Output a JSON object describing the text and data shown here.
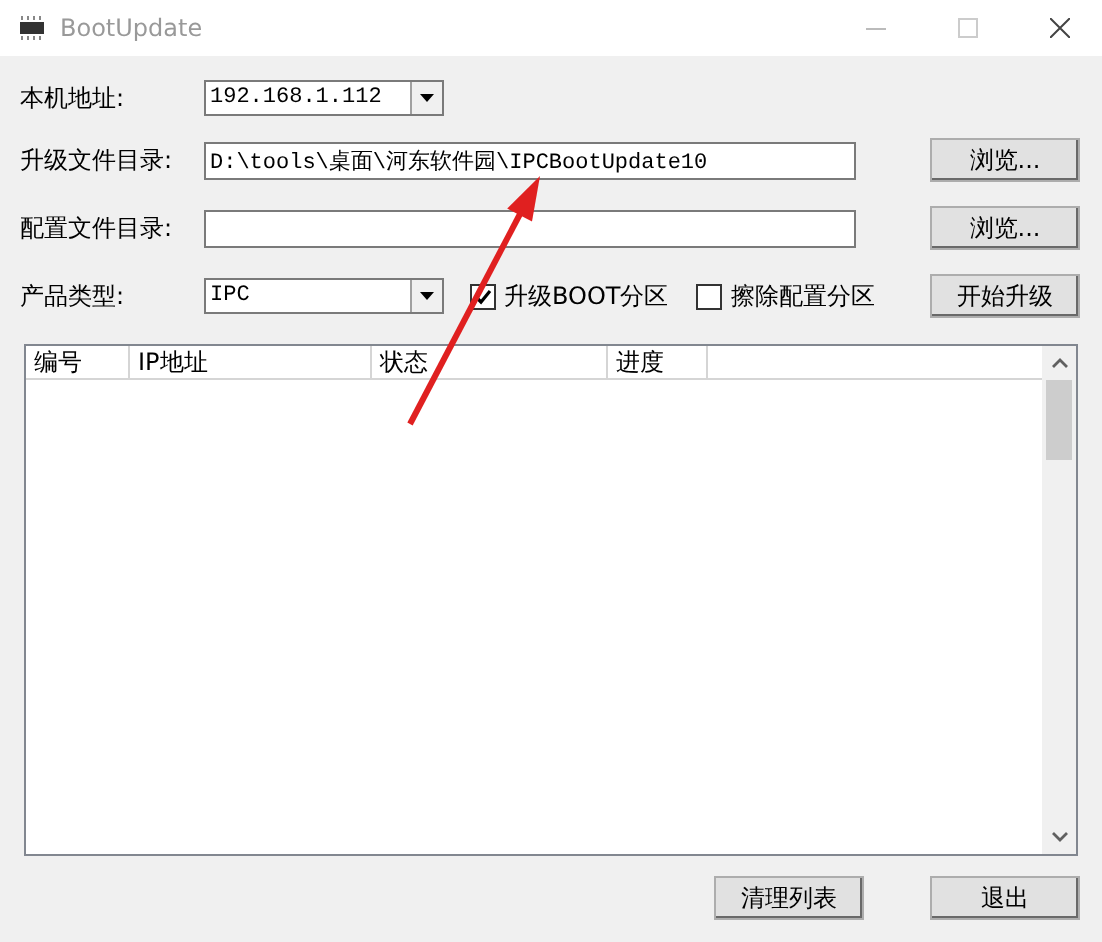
{
  "window": {
    "title": "BootUpdate"
  },
  "local_address": {
    "label": "本机地址:",
    "value": "192.168.1.112"
  },
  "upgrade_dir": {
    "label": "升级文件目录:",
    "value": "D:\\tools\\桌面\\河东软件园\\IPCBootUpdate10",
    "button": "浏览..."
  },
  "config_dir": {
    "label": "配置文件目录:",
    "button": "浏览..."
  },
  "product_type": {
    "label": "产品类型:",
    "value": "IPC"
  },
  "options": [
    {
      "label": "升级BOOT分区",
      "checked": true
    },
    {
      "label": "擦除配置分区",
      "checked": false
    }
  ],
  "start_button": "开始升级",
  "table": {
    "columns": [
      "编号",
      "IP地址",
      "状态",
      "进度"
    ]
  },
  "buttons": [
    "清理列表",
    "退出"
  ]
}
